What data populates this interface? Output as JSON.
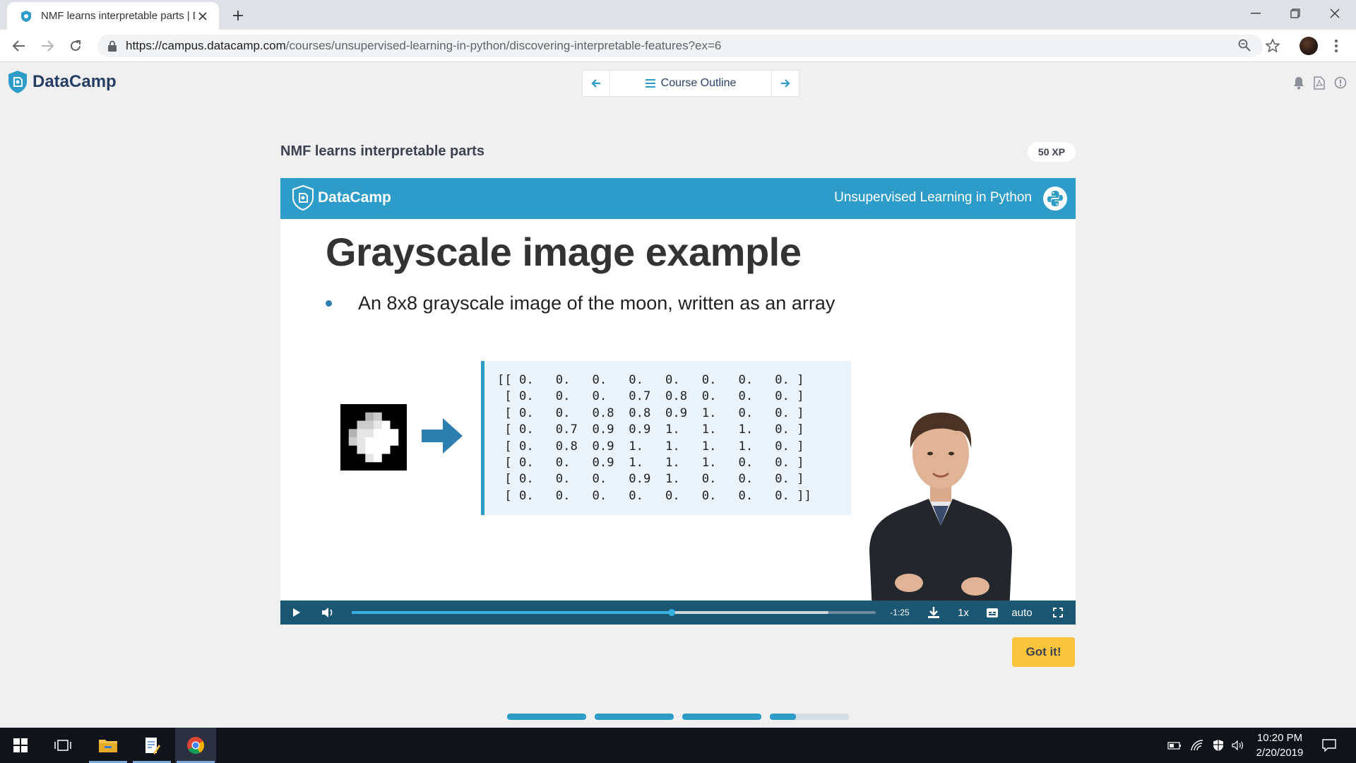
{
  "browser": {
    "tab_title": "NMF learns interpretable parts | D",
    "url_host": "https://campus.datacamp.com",
    "url_path": "/courses/unsupervised-learning-in-python/discovering-interpretable-features?ex=6",
    "icons": [
      "back-icon",
      "forward-icon",
      "reload-icon",
      "lock-icon",
      "zoom-icon",
      "star-icon",
      "profile-avatar",
      "menu-icon"
    ]
  },
  "header": {
    "logo_text": "DataCamp",
    "outline_label": "Course Outline",
    "right_icons": [
      "notification-icon",
      "pdf-icon",
      "info-icon"
    ]
  },
  "exercise": {
    "title": "NMF learns interpretable parts",
    "xp": "50 XP",
    "got_it": "Got it!"
  },
  "slide": {
    "band_logo": "DataCamp",
    "course_name": "Unsupervised Learning in Python",
    "heading": "Grayscale image example",
    "bullet": "An 8x8 grayscale image of the moon, written as an array",
    "matrix_text": "[[ 0.   0.   0.   0.   0.   0.   0.   0. ]\n [ 0.   0.   0.   0.7  0.8  0.   0.   0. ]\n [ 0.   0.   0.8  0.8  0.9  1.   0.   0. ]\n [ 0.   0.7  0.9  0.9  1.   1.   1.   0. ]\n [ 0.   0.8  0.9  1.   1.   1.   1.   0. ]\n [ 0.   0.   0.9  1.   1.   1.   0.   0. ]\n [ 0.   0.   0.   0.9  1.   0.   0.   0. ]\n [ 0.   0.   0.   0.   0.   0.   0.   0. ]]",
    "moon_pixels": [
      [
        0,
        0,
        0,
        0,
        0,
        0,
        0,
        0
      ],
      [
        0,
        0,
        0,
        0.7,
        0.8,
        0,
        0,
        0
      ],
      [
        0,
        0,
        0.8,
        0.8,
        0.9,
        1,
        0,
        0
      ],
      [
        0,
        0.7,
        0.9,
        0.9,
        1,
        1,
        1,
        0
      ],
      [
        0,
        0.8,
        0.9,
        1,
        1,
        1,
        1,
        0
      ],
      [
        0,
        0,
        0.9,
        1,
        1,
        1,
        0,
        0
      ],
      [
        0,
        0,
        0,
        0.9,
        1,
        0,
        0,
        0
      ],
      [
        0,
        0,
        0,
        0,
        0,
        0,
        0,
        0
      ]
    ]
  },
  "player": {
    "time_remaining": "-1:25",
    "speed": "1x",
    "quality": "auto",
    "played_fraction": 0.61,
    "buffered_fraction": 0.91
  },
  "progress_segments": [
    1,
    1,
    1,
    0.33
  ],
  "taskbar": {
    "time": "10:20 PM",
    "date": "2/20/2019",
    "apps": [
      "start-icon",
      "task-view-icon",
      "file-explorer-icon",
      "notepad-icon",
      "chrome-icon"
    ]
  },
  "colors": {
    "brand_blue": "#2d9cc8",
    "brand_navy": "#263e63",
    "button_yellow": "#fbc43d",
    "player_bar": "#1b5773"
  }
}
